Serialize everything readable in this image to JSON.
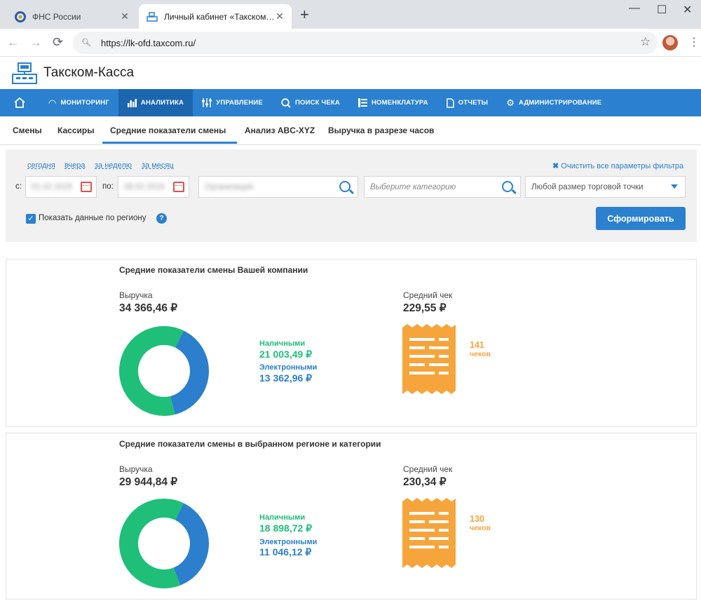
{
  "browser": {
    "tabs": [
      {
        "title": "ФНС России",
        "close": "✕"
      },
      {
        "title": "Личный кабинет «Такском-Касса»",
        "close": "✕"
      }
    ],
    "new_tab": "+",
    "url": "https://lk-ofd.taxcom.ru/"
  },
  "brand": {
    "name": "Такском-Касса"
  },
  "main_nav": [
    {
      "label": "МОНИТОРИНГ",
      "icon": "gauge-icon"
    },
    {
      "label": "АНАЛИТИКА",
      "icon": "bar-chart-icon",
      "active": true
    },
    {
      "label": "УПРАВЛЕНИЕ",
      "icon": "sliders-icon"
    },
    {
      "label": "ПОИСК ЧЕКА",
      "icon": "search-icon"
    },
    {
      "label": "НОМЕНКЛАТУРА",
      "icon": "list-icon"
    },
    {
      "label": "ОТЧЕТЫ",
      "icon": "document-icon"
    },
    {
      "label": "АДМИНИСТРИРОВАНИЕ",
      "icon": "gear-icon"
    }
  ],
  "sub_tabs": [
    {
      "label": "Смены"
    },
    {
      "label": "Кассиры"
    },
    {
      "label": "Средние показатели смены",
      "active": true
    },
    {
      "label": "Анализ ABC-XYZ"
    },
    {
      "label": "Выручка в разрезе часов"
    }
  ],
  "filter": {
    "quick_periods": [
      "сегодня",
      "вчера",
      "за неделю",
      "за месяц"
    ],
    "clear_label": "Очистить все параметры фильтра",
    "from_label": "с:",
    "to_label": "по:",
    "from_value": "01.02.2019",
    "to_value": "08.02.2019",
    "org_value": "Организация",
    "category_placeholder": "Выберите категорию",
    "size_value": "Любой размер торговой точки",
    "region_checkbox_label": "Показать данные по региону",
    "region_checked": true,
    "submit_label": "Сформировать"
  },
  "cards": [
    {
      "title": "Средние показатели смены Вашей компании",
      "revenue_label": "Выручка",
      "revenue_value": "34 366,46 ₽",
      "cash_label": "Наличными",
      "cash_value": "21 003,49 ₽",
      "electronic_label": "Электронными",
      "electronic_value": "13 362,96 ₽",
      "avg_check_label": "Средний чек",
      "avg_check_value": "229,55 ₽",
      "checks_count": "141",
      "checks_unit": "чеков"
    },
    {
      "title": "Средние показатели смены в выбранном регионе и категории",
      "revenue_label": "Выручка",
      "revenue_value": "29 944,84 ₽",
      "cash_label": "Наличными",
      "cash_value": "18 898,72 ₽",
      "electronic_label": "Электронными",
      "electronic_value": "11 046,12 ₽",
      "avg_check_label": "Средний чек",
      "avg_check_value": "230,34 ₽",
      "checks_count": "130",
      "checks_unit": "чеков"
    }
  ],
  "donut_shares": [
    {
      "cash": 21003.49,
      "electronic": 13362.96
    },
    {
      "cash": 18898.72,
      "electronic": 11046.12
    }
  ],
  "colors": {
    "primary": "#2b80d0",
    "cash": "#1fbf7a",
    "electronic": "#2b7fcd",
    "receipt": "#f6a53d"
  }
}
